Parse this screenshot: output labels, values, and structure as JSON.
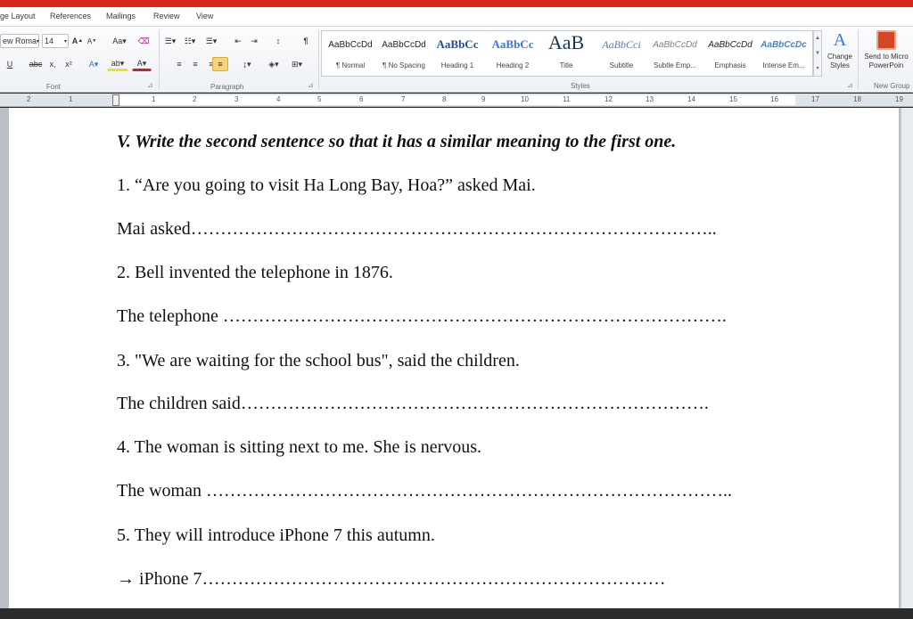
{
  "menu_tabs": [
    "ge Layout",
    "References",
    "Mailings",
    "Review",
    "View"
  ],
  "font_group": {
    "font_name": "ew Roma",
    "font_size": "14",
    "label": "Font"
  },
  "paragraph_group": {
    "label": "Paragraph"
  },
  "styles_group": {
    "label": "Styles",
    "items": [
      {
        "sample": "AaBbCcDd",
        "name": "¶ Normal"
      },
      {
        "sample": "AaBbCcDd",
        "name": "¶ No Spacing"
      },
      {
        "sample": "AaBbCc",
        "name": "Heading 1"
      },
      {
        "sample": "AaBbCc",
        "name": "Heading 2"
      },
      {
        "sample": "AaB",
        "name": "Title"
      },
      {
        "sample": "AaBbCci",
        "name": "Subtitle"
      },
      {
        "sample": "AaBbCcDd",
        "name": "Subtle Emp..."
      },
      {
        "sample": "AaBbCcDd",
        "name": "Emphasis"
      },
      {
        "sample": "AaBbCcDc",
        "name": "Intense Em..."
      }
    ],
    "change_styles": "Change Styles"
  },
  "new_group": {
    "button": "Send to Micro PowerPoin",
    "label": "New Group"
  },
  "ruler_numbers": [
    "2",
    "1",
    "1",
    "2",
    "3",
    "4",
    "5",
    "6",
    "7",
    "8",
    "9",
    "10",
    "11",
    "12",
    "13",
    "14",
    "15",
    "16",
    "17",
    "18",
    "19"
  ],
  "document": {
    "heading": "V. Write the second sentence so that it has a similar meaning to the first one.",
    "lines": [
      "1. “Are you going to visit Ha Long Bay, Hoa?” asked Mai.",
      "Mai asked……………………………………………………………………………..",
      "2. Bell invented the telephone  in 1876.",
      "The telephone  ………………………………………………………………………….",
      "3. \"We are waiting for the school bus\", said the children.",
      "The children said…………………………………………………………………….",
      "4. The woman is sitting next to me. She is nervous.",
      "The woman ……………………………………………………………………………..",
      "5. They will introduce  iPhone 7 this autumn.",
      "→ iPhone 7……………………………………………………………………"
    ]
  },
  "colors": {
    "title_bar": "#d9261c",
    "highlight_button": "#f7d37a"
  }
}
